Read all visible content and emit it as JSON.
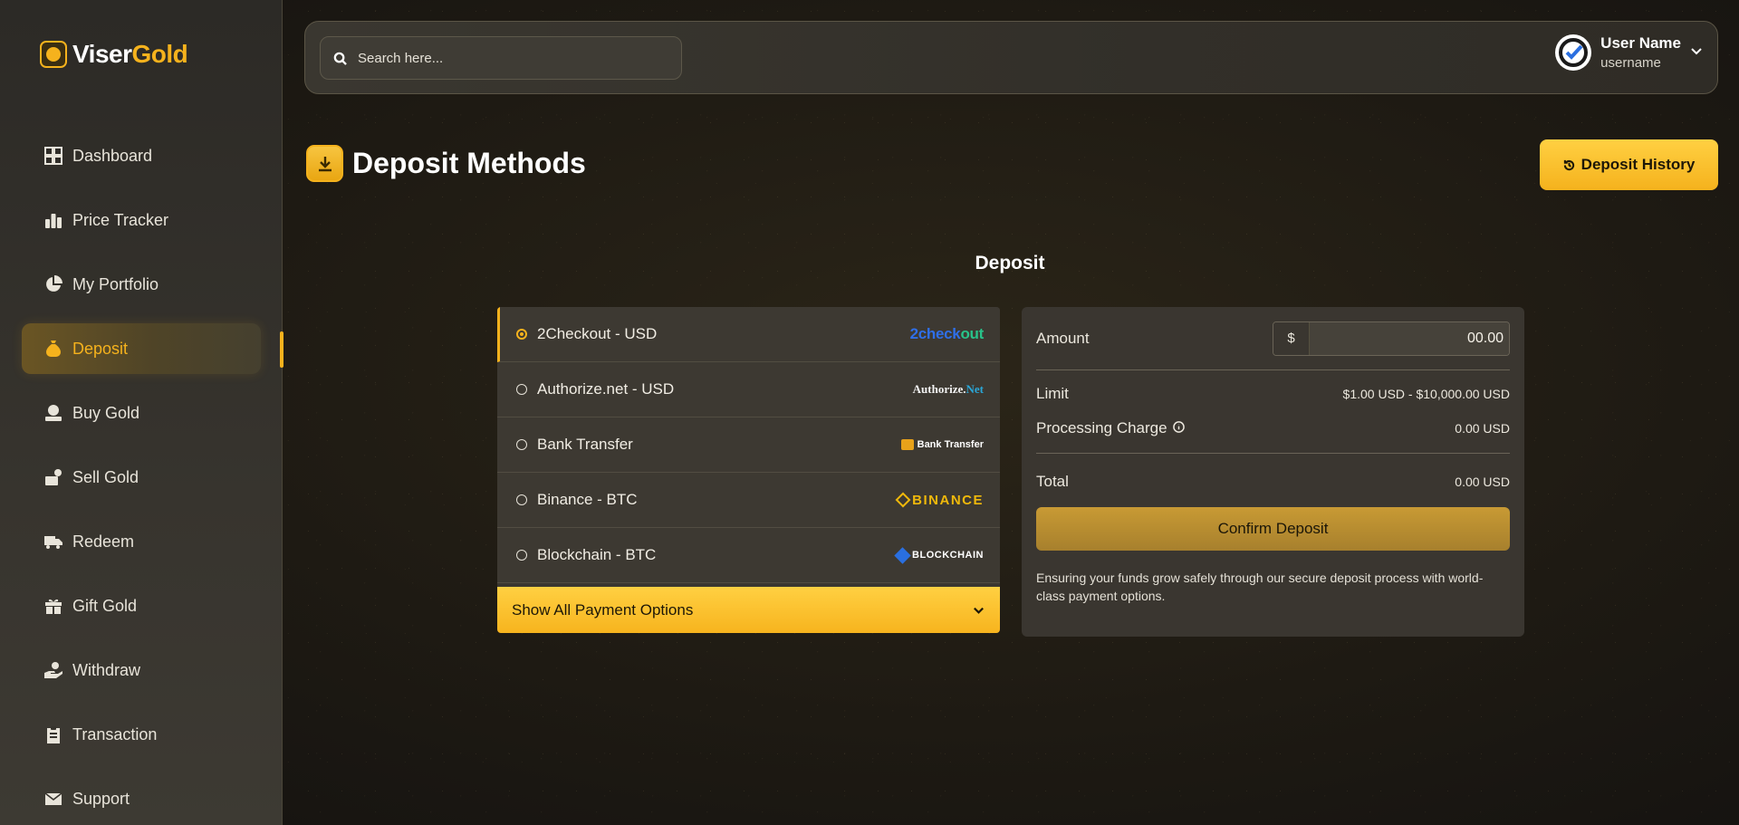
{
  "brand": {
    "name_part1": "Viser",
    "name_part2": "Gold"
  },
  "sidebar": {
    "items": [
      {
        "label": "Dashboard",
        "icon": "dashboard-icon"
      },
      {
        "label": "Price Tracker",
        "icon": "bar-chart-icon"
      },
      {
        "label": "My Portfolio",
        "icon": "pie-chart-icon"
      },
      {
        "label": "Deposit",
        "icon": "money-bag-icon",
        "active": true
      },
      {
        "label": "Buy Gold",
        "icon": "buy-gold-icon"
      },
      {
        "label": "Sell Gold",
        "icon": "sell-gold-icon"
      },
      {
        "label": "Redeem",
        "icon": "truck-icon"
      },
      {
        "label": "Gift Gold",
        "icon": "gift-icon"
      },
      {
        "label": "Withdraw",
        "icon": "hand-coin-icon"
      },
      {
        "label": "Transaction",
        "icon": "clipboard-icon"
      },
      {
        "label": "Support",
        "icon": "envelope-icon"
      }
    ]
  },
  "header": {
    "search_placeholder": "Search here...",
    "user_name": "User Name",
    "user_handle": "username"
  },
  "page": {
    "title": "Deposit Methods",
    "history_button": "Deposit History",
    "section_heading": "Deposit"
  },
  "methods": {
    "items": [
      {
        "name": "2Checkout - USD",
        "logo_a": "2check",
        "logo_b": "out",
        "selected": true
      },
      {
        "name": "Authorize.net - USD",
        "logo_a": "Authorize.",
        "logo_b": "Net"
      },
      {
        "name": "Bank Transfer",
        "logo_a": "Bank Transfer"
      },
      {
        "name": "Binance - BTC",
        "logo_a": "BINANCE"
      },
      {
        "name": "Blockchain - BTC",
        "logo_a": "BLOCKCHAIN"
      }
    ],
    "show_all_label": "Show All Payment Options"
  },
  "summary": {
    "amount_label": "Amount",
    "currency_symbol": "$",
    "amount_placeholder": "00.00",
    "limit_label": "Limit",
    "limit_value": "$1.00 USD - $10,000.00 USD",
    "charge_label": "Processing Charge",
    "charge_value": "0.00 USD",
    "total_label": "Total",
    "total_value": "0.00 USD",
    "confirm_label": "Confirm Deposit",
    "note": "Ensuring your funds grow safely through our secure deposit process with world-class payment options."
  },
  "colors": {
    "accent": "#f5b21d",
    "background": "#1d1912",
    "panel": "#3a3630"
  }
}
